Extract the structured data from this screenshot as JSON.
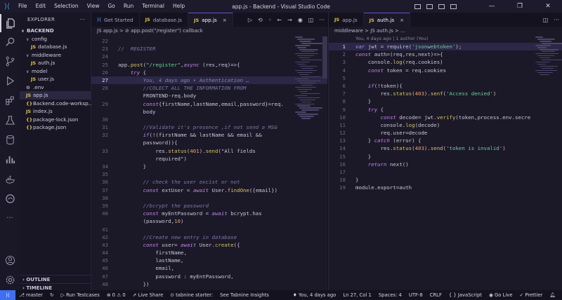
{
  "window": {
    "title": "app.js - Backend - Visual Studio Code",
    "menu": [
      "File",
      "Edit",
      "Selection",
      "View",
      "Go",
      "Run",
      "Terminal",
      "Help"
    ],
    "controls": [
      "—",
      "❐",
      "✕"
    ]
  },
  "activity_bar": [
    "explorer-icon",
    "search-icon",
    "source-control-icon",
    "run-debug-icon",
    "extensions-icon",
    "testing-icon",
    "database-icon",
    "chart-icon",
    "docker-icon",
    "edge-icon",
    "more-icon",
    "account-icon",
    "settings-icon"
  ],
  "sidebar": {
    "title": "EXPLORER",
    "more": "···",
    "root": "BACKEND",
    "items": [
      {
        "label": "config",
        "type": "folder",
        "depth": 1
      },
      {
        "label": "database.js",
        "type": "js",
        "depth": 2
      },
      {
        "label": "middleware",
        "type": "folder",
        "depth": 1
      },
      {
        "label": "auth.js",
        "type": "js",
        "depth": 2
      },
      {
        "label": "model",
        "type": "folder",
        "depth": 1
      },
      {
        "label": "user.js",
        "type": "js",
        "depth": 2
      },
      {
        "label": ".env",
        "type": "env",
        "depth": 1
      },
      {
        "label": "app.js",
        "type": "js",
        "depth": 1,
        "selected": true
      },
      {
        "label": "Backend.code-worksp...",
        "type": "json",
        "depth": 1
      },
      {
        "label": "index.js",
        "type": "js",
        "depth": 1
      },
      {
        "label": "package-lock.json",
        "type": "json",
        "depth": 1
      },
      {
        "label": "package.json",
        "type": "json",
        "depth": 1
      }
    ],
    "outline": "OUTLINE",
    "timeline": "TIMELINE"
  },
  "editor1": {
    "tabs": [
      {
        "label": "Get Started",
        "icon": "vscode-icon",
        "active": false
      },
      {
        "label": "database.js",
        "icon": "JS",
        "active": false
      },
      {
        "label": "app.js",
        "icon": "JS",
        "active": true
      }
    ],
    "breadcrumb": "JS app.js > ⊘ app.post(\"/register\") callback",
    "lines": [
      {
        "n": "22",
        "t": ""
      },
      {
        "n": "23",
        "t": "//  REGISTER"
      },
      {
        "n": "24",
        "t": ""
      },
      {
        "n": "25",
        "t": "app.post(\"/register\",async (res,req)=>{"
      },
      {
        "n": "26",
        "t": "    try {"
      },
      {
        "n": "27",
        "t": "        You, 4 days ago • Authentication …"
      },
      {
        "n": "28",
        "t": "        //COLECT ALL THE INFORMATION FROM"
      },
      {
        "n": "",
        "t": "        FRONTEND-req.body"
      },
      {
        "n": "29",
        "t": "        const{firstName,lastName,email,password}=req."
      },
      {
        "n": "",
        "t": "        body"
      },
      {
        "n": "30",
        "t": ""
      },
      {
        "n": "31",
        "t": "        //Validate it's presence ,if not send a MSG"
      },
      {
        "n": "32",
        "t": "        if(!(firstName && lastName && email &&"
      },
      {
        "n": "",
        "t": "        password)){"
      },
      {
        "n": "33",
        "t": "            res.status(401).send(\"All fields"
      },
      {
        "n": "",
        "t": "            required\")"
      },
      {
        "n": "34",
        "t": "        }"
      },
      {
        "n": "35",
        "t": ""
      },
      {
        "n": "36",
        "t": "        // check the user excist or not"
      },
      {
        "n": "37",
        "t": "        const extUser = await User.findOne({email})"
      },
      {
        "n": "38",
        "t": ""
      },
      {
        "n": "39",
        "t": "        //bcrypt the password"
      },
      {
        "n": "40",
        "t": "        const myEntPassword = await bcrypt.has"
      },
      {
        "n": "",
        "t": "        (password,10)"
      },
      {
        "n": "41",
        "t": ""
      },
      {
        "n": "42",
        "t": "        //Create new entry in database"
      },
      {
        "n": "43",
        "t": "        const user= await User.create({"
      },
      {
        "n": "44",
        "t": "            firstName,"
      },
      {
        "n": "45",
        "t": "            lastName,"
      },
      {
        "n": "46",
        "t": "            email,"
      },
      {
        "n": "47",
        "t": "            password : myEntPassword,"
      },
      {
        "n": "48",
        "t": "        })"
      },
      {
        "n": "49",
        "t": ""
      }
    ]
  },
  "editor2": {
    "tabs": [
      {
        "label": "app.js",
        "icon": "JS",
        "active": false
      },
      {
        "label": "auth.js",
        "icon": "JS",
        "active": true
      }
    ],
    "breadcrumb": "middleware > JS auth.js > ...",
    "blame": "You, 4 days ago | 1 author (You)",
    "lines": [
      {
        "n": "1",
        "t": "var jwt = require('jsonwebtoken');"
      },
      {
        "n": "2",
        "t": "const auth=(req,res,next)=>{"
      },
      {
        "n": "3",
        "t": "    console.log(req.cookies)"
      },
      {
        "n": "4",
        "t": "    const token = req.cookies"
      },
      {
        "n": "5",
        "t": ""
      },
      {
        "n": "6",
        "t": "    if(!token){"
      },
      {
        "n": "7",
        "t": "        res.status(403).senf('Access denied')"
      },
      {
        "n": "8",
        "t": "    }"
      },
      {
        "n": "9",
        "t": "    try {"
      },
      {
        "n": "10",
        "t": "        const decode= jwt.verify(token,process.env.secre"
      },
      {
        "n": "11",
        "t": "        console.log(decode)"
      },
      {
        "n": "12",
        "t": "        req.user=decode"
      },
      {
        "n": "13",
        "t": "    } catch (error) {"
      },
      {
        "n": "14",
        "t": "        res.status(403).send('token is invalid')"
      },
      {
        "n": "15",
        "t": "    }"
      },
      {
        "n": "16",
        "t": "    return next()"
      },
      {
        "n": "17",
        "t": ""
      },
      {
        "n": "18",
        "t": "}"
      },
      {
        "n": "19",
        "t": "module.export=auth"
      }
    ]
  },
  "statusbar": {
    "branch": "master",
    "sync": "↻",
    "run_testcases": "Run Testcases",
    "problems": "⊗ 0  ⚠ 0",
    "live_share": "Live Share",
    "tabnine": "tabnine starter:",
    "tabnine_insights": "See Tabnine Insights",
    "blame": "You, 4 days ago",
    "position": "Ln 27, Col 1",
    "spaces": "Spaces: 4",
    "encoding": "UTF-8",
    "eol": "CRLF",
    "language": "JavaScript",
    "golive": "Go Live",
    "prettier": "✓ Prettier"
  }
}
